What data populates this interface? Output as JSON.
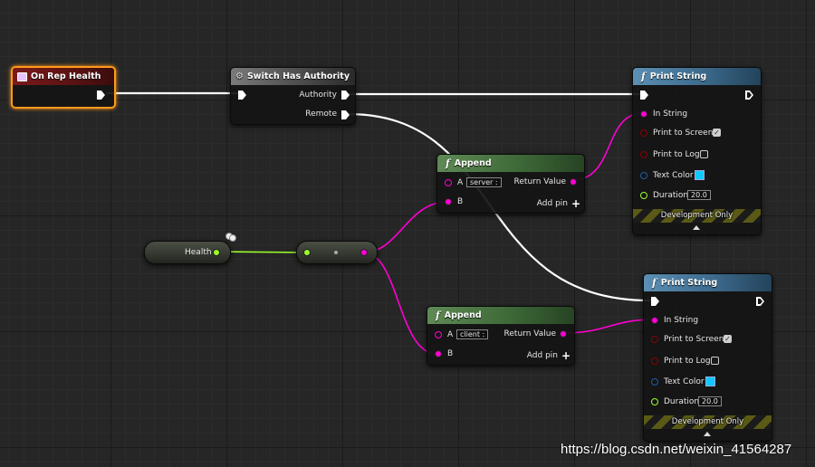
{
  "event_node": {
    "title": "On Rep Health"
  },
  "switch_node": {
    "title": "Switch Has Authority",
    "pin_authority": "Authority",
    "pin_remote": "Remote"
  },
  "print_string_top": {
    "title": "Print String",
    "in_string": "In String",
    "print_to_screen": "Print to Screen",
    "print_to_screen_checked": true,
    "print_to_log": "Print to Log",
    "print_to_log_checked": false,
    "text_color": "Text Color",
    "text_color_value": "#10c8ff",
    "duration": "Duration",
    "duration_value": "20.0",
    "development_only": "Development Only"
  },
  "print_string_bottom": {
    "title": "Print String",
    "in_string": "In String",
    "print_to_screen": "Print to Screen",
    "print_to_screen_checked": true,
    "print_to_log": "Print to Log",
    "print_to_log_checked": false,
    "text_color": "Text Color",
    "text_color_value": "#10c8ff",
    "duration": "Duration",
    "duration_value": "20.0",
    "development_only": "Development Only"
  },
  "append_top": {
    "title": "Append",
    "pin_a": "A",
    "pin_a_value": "server :",
    "pin_b": "B",
    "return_value": "Return Value",
    "add_pin": "Add pin"
  },
  "append_bottom": {
    "title": "Append",
    "pin_a": "A",
    "pin_a_value": "client  :",
    "pin_b": "B",
    "return_value": "Return Value",
    "add_pin": "Add pin"
  },
  "health_var": {
    "label": "Health"
  },
  "function_icon": "f",
  "colors": {
    "exec_wire": "#ffffff",
    "string_wire": "#ff00d4",
    "float_wire": "#9bff2a",
    "event_selected": "#ff9a1c",
    "bool_pin": "#8c0000",
    "struct_pin": "#1c5ea8",
    "float_pin": "#9bff2a"
  },
  "watermark": "https://blog.csdn.net/weixin_41564287"
}
